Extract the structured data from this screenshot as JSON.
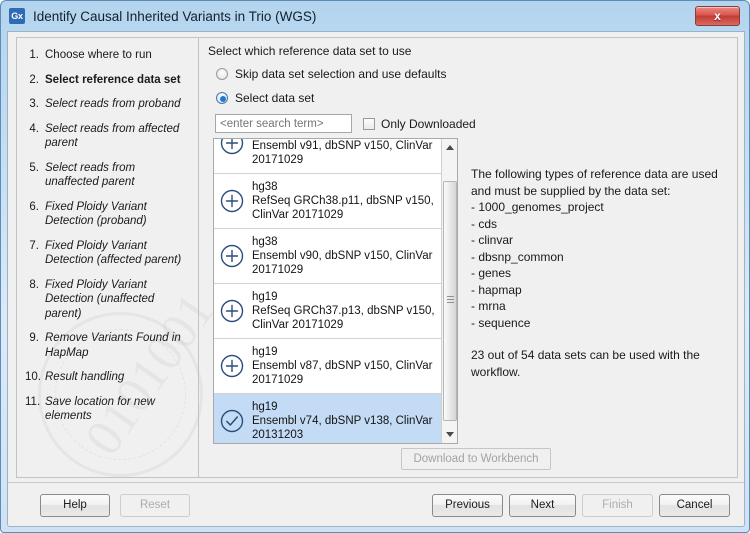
{
  "window": {
    "title": "Identify Causal Inherited Variants in Trio (WGS)",
    "app_icon_label": "Gx",
    "close_label": "x"
  },
  "sidebar": {
    "steps": [
      {
        "num": "1.",
        "label": "Choose where to run",
        "state": "done"
      },
      {
        "num": "2.",
        "label": "Select reference data set",
        "state": "current"
      },
      {
        "num": "3.",
        "label": "Select reads from proband",
        "state": "future"
      },
      {
        "num": "4.",
        "label": "Select reads from affected parent",
        "state": "future"
      },
      {
        "num": "5.",
        "label": "Select reads from unaffected parent",
        "state": "future"
      },
      {
        "num": "6.",
        "label": "Fixed Ploidy Variant Detection (proband)",
        "state": "future"
      },
      {
        "num": "7.",
        "label": "Fixed Ploidy Variant Detection (affected parent)",
        "state": "future"
      },
      {
        "num": "8.",
        "label": "Fixed Ploidy Variant Detection (unaffected parent)",
        "state": "future"
      },
      {
        "num": "9.",
        "label": "Remove Variants Found in HapMap",
        "state": "future"
      },
      {
        "num": "10.",
        "label": "Result handling",
        "state": "future"
      },
      {
        "num": "11.",
        "label": "Save location for new elements",
        "state": "future"
      }
    ]
  },
  "main": {
    "heading": "Select which reference data set to use",
    "radio_skip_label": "Skip data set selection and use defaults",
    "radio_select_label": "Select data set",
    "radio_selected": "select_data_set",
    "search_placeholder": "<enter search term>",
    "search_value": "",
    "only_downloaded_label": "Only Downloaded",
    "only_downloaded_checked": false,
    "download_button_label": "Download to Workbench",
    "download_button_enabled": false,
    "datasets": [
      {
        "title": "",
        "desc": "Ensembl v91, dbSNP v150, ClinVar 20171029",
        "icon": "plus-circle-icon",
        "selected": false,
        "clipped": true
      },
      {
        "title": "hg38",
        "desc": "RefSeq GRCh38.p11, dbSNP v150, ClinVar 20171029",
        "icon": "plus-circle-icon",
        "selected": false,
        "clipped": false
      },
      {
        "title": "hg38",
        "desc": "Ensembl v90, dbSNP v150, ClinVar 20171029",
        "icon": "plus-circle-icon",
        "selected": false,
        "clipped": false
      },
      {
        "title": "hg19",
        "desc": "RefSeq GRCh37.p13, dbSNP v150, ClinVar 20171029",
        "icon": "plus-circle-icon",
        "selected": false,
        "clipped": false
      },
      {
        "title": "hg19",
        "desc": "Ensembl v87, dbSNP v150, ClinVar 20171029",
        "icon": "plus-circle-icon",
        "selected": false,
        "clipped": false
      },
      {
        "title": "hg19",
        "desc": "Ensembl v74, dbSNP v138, ClinVar 20131203",
        "icon": "check-circle-icon",
        "selected": true,
        "clipped": false
      }
    ],
    "info": {
      "intro": "The following types of reference data are used and must be supplied by the data set:",
      "types": [
        "- 1000_genomes_project",
        "- cds",
        "- clinvar",
        "- dbsnp_common",
        "- genes",
        "- hapmap",
        "- mrna",
        "- sequence"
      ],
      "summary": "23 out of 54 data sets can be used with the workflow."
    }
  },
  "footer": {
    "help_label": "Help",
    "reset_label": "Reset",
    "previous_label": "Previous",
    "next_label": "Next",
    "finish_label": "Finish",
    "cancel_label": "Cancel"
  },
  "colors": {
    "selection": "#c3dbf5",
    "accent": "#2277cc",
    "titlebar": "#b4d4ee",
    "close_red": "#c23b33"
  }
}
